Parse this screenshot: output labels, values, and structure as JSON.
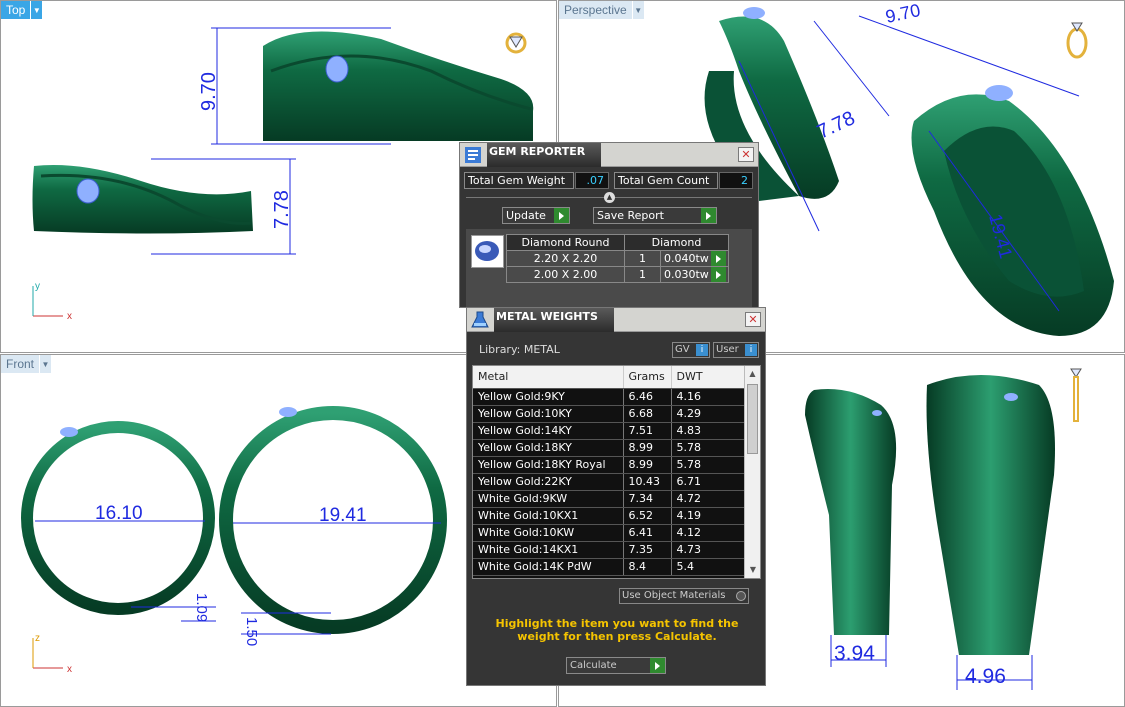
{
  "viewports": {
    "top": {
      "label": "Top",
      "axes": {
        "y": "y",
        "x": "x"
      },
      "dims": [
        "9.70",
        "7.78"
      ]
    },
    "perspective": {
      "label": "Perspective",
      "dims": [
        "9.70",
        "7.78",
        "19.41"
      ]
    },
    "front": {
      "label": "Front",
      "axes": {
        "z": "z",
        "x": "x"
      },
      "dims": [
        "16.10",
        "19.41",
        "1.09",
        "1.50"
      ]
    },
    "right": {
      "dims": [
        "3.94",
        "4.96"
      ]
    }
  },
  "gem_reporter": {
    "title": "GEM REPORTER",
    "total_weight_label": "Total Gem Weight",
    "total_weight_value": ".07",
    "total_count_label": "Total Gem Count",
    "total_count_value": "2",
    "update_label": "Update",
    "save_report_label": "Save Report",
    "table_header": [
      "Diamond Round",
      "Diamond"
    ],
    "rows": [
      {
        "size": "2.20 X 2.20",
        "qty": "1",
        "weight": "0.040tw"
      },
      {
        "size": "2.00 X 2.00",
        "qty": "1",
        "weight": "0.030tw"
      }
    ]
  },
  "metal_weights": {
    "title": "METAL WEIGHTS",
    "library_label": "Library: METAL",
    "gv_label": "GV",
    "user_label": "User",
    "columns": [
      "Metal",
      "Grams",
      "DWT"
    ],
    "rows": [
      {
        "metal": "Yellow Gold:9KY",
        "grams": "6.46",
        "dwt": "4.16"
      },
      {
        "metal": "Yellow Gold:10KY",
        "grams": "6.68",
        "dwt": "4.29"
      },
      {
        "metal": "Yellow Gold:14KY",
        "grams": "7.51",
        "dwt": "4.83"
      },
      {
        "metal": "Yellow Gold:18KY",
        "grams": "8.99",
        "dwt": "5.78"
      },
      {
        "metal": "Yellow Gold:18KY Royal",
        "grams": "8.99",
        "dwt": "5.78"
      },
      {
        "metal": "Yellow Gold:22KY",
        "grams": "10.43",
        "dwt": "6.71"
      },
      {
        "metal": "White Gold:9KW",
        "grams": "7.34",
        "dwt": "4.72"
      },
      {
        "metal": "White Gold:10KX1",
        "grams": "6.52",
        "dwt": "4.19"
      },
      {
        "metal": "White Gold:10KW",
        "grams": "6.41",
        "dwt": "4.12"
      },
      {
        "metal": "White Gold:14KX1",
        "grams": "7.35",
        "dwt": "4.73"
      },
      {
        "metal": "White Gold:14K PdW",
        "grams": "8.4",
        "dwt": "5.4"
      }
    ],
    "use_object_materials_label": "Use Object Materials",
    "instruction": "Highlight the item you want to find the weight for then press Calculate.",
    "calculate_label": "Calculate"
  },
  "colors": {
    "metal_green": "#0f6a43",
    "dimension_blue": "#1f2ae0",
    "instruction_yellow": "#f5c400",
    "viewport_tab_active": "#3aa6e6"
  }
}
